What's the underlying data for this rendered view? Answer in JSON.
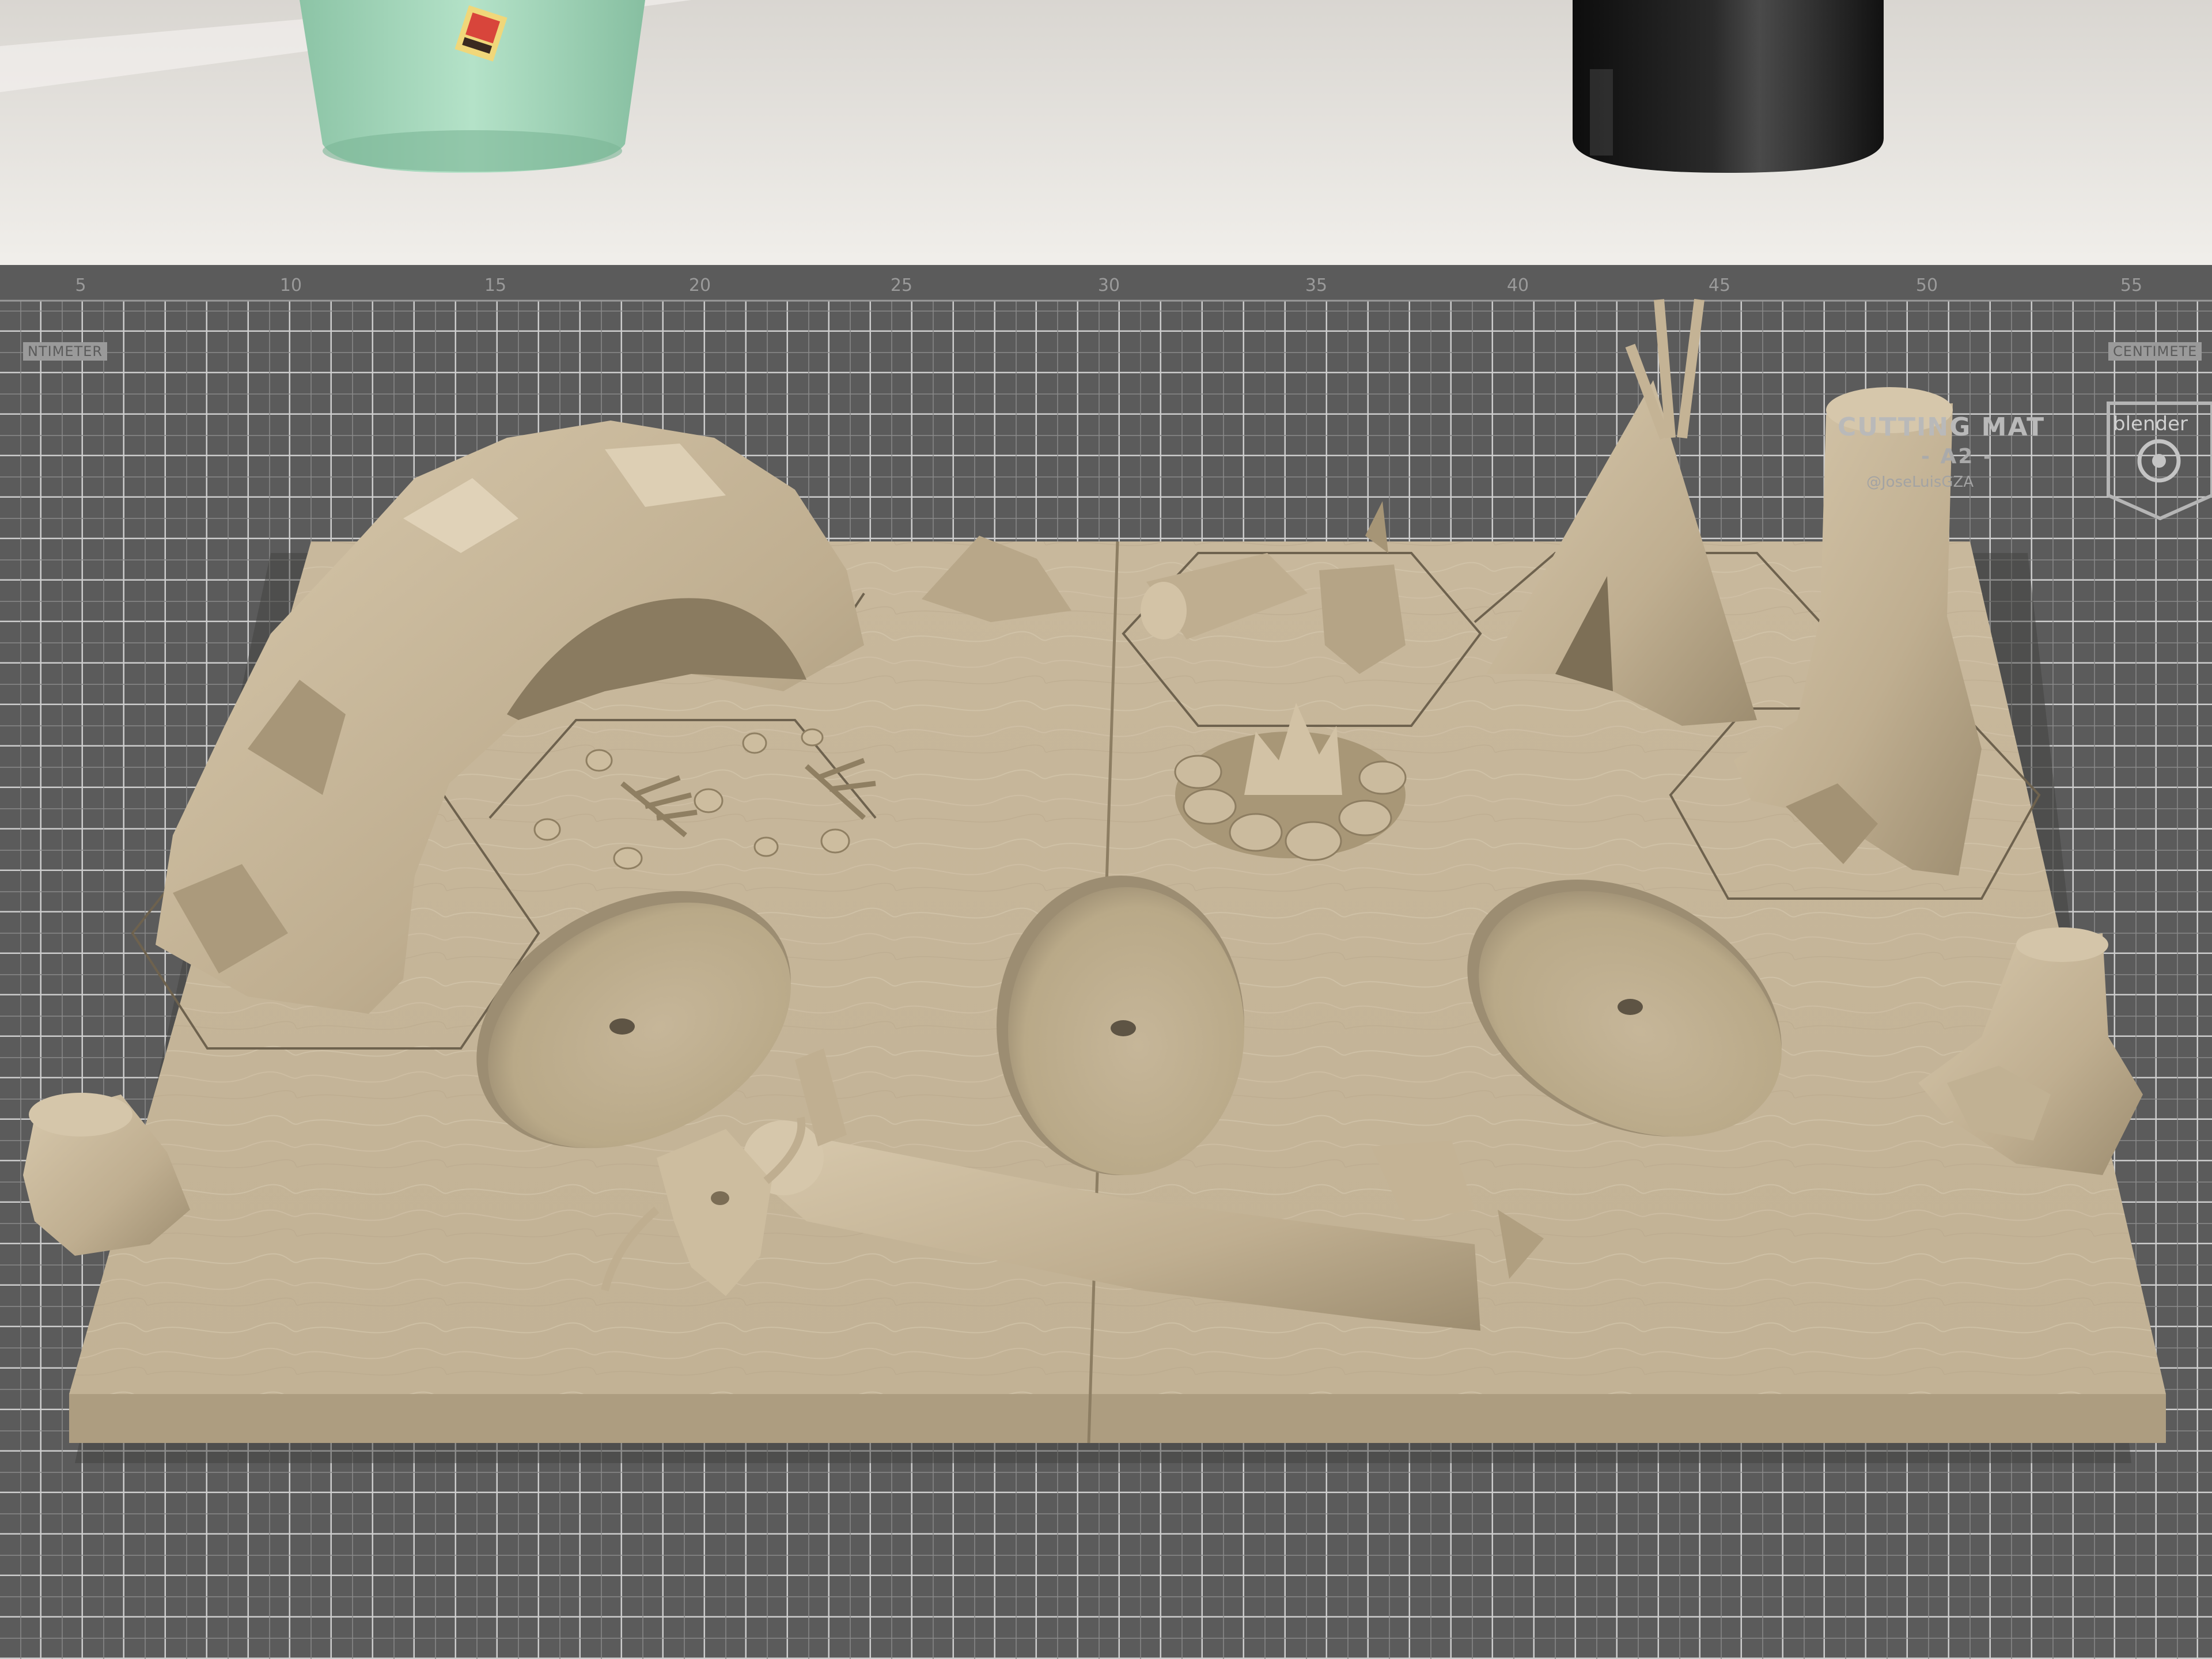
{
  "ruler": {
    "numbers": [
      "5",
      "10",
      "15",
      "20",
      "25",
      "30",
      "35",
      "40",
      "45",
      "50",
      "55"
    ]
  },
  "mat": {
    "title": "CUTTING MAT",
    "size": "- A2 -",
    "handle": "@JoseLuisGZA",
    "cm_right": "CENTIMETE",
    "cm_left": "NTIMETER",
    "logo_text": "blender"
  },
  "colors": {
    "mat": "#5b5b5b",
    "grid_line": "#cfcfcf",
    "wall": "#e9e6e1",
    "board": "#c9b99e",
    "board_shadow": "#8f806a",
    "mint_pot": "#a8d9bf",
    "jar": "#1b1b1b"
  },
  "objects": {
    "pot_icon": "mint-flower-pot-icon",
    "jar_icon": "black-ink-jar-icon",
    "cave_icon": "rock-cave-icon",
    "teepee_icon": "teepee-tent-icon",
    "campfire_icon": "campfire-stones-icon",
    "stump_icon": "tree-stump-icon",
    "log_icon": "fallen-log-icon",
    "skull_icon": "animal-skull-icon",
    "bones_icon": "skeleton-bones-icon"
  }
}
